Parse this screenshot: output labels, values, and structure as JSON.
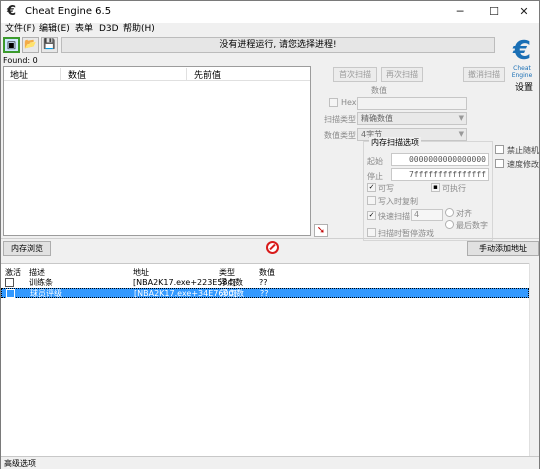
{
  "window": {
    "title": "Cheat Engine 6.5",
    "minimize": "─",
    "maximize": "☐",
    "close": "✕"
  },
  "menu": [
    "文件(F)",
    "编辑(E)",
    "表单",
    "D3D",
    "帮助(H)"
  ],
  "toolbar": {
    "process_label": "没有进程运行, 请您选择进程!",
    "logo_caption": "Cheat Engine",
    "settings_label": "设置"
  },
  "found_label": "Found: 0",
  "results": {
    "columns": [
      "地址",
      "数值",
      "先前值"
    ]
  },
  "scan": {
    "first_scan": "首次扫描",
    "next_scan": "再次扫描",
    "undo_scan": "撤消扫描",
    "value_label": "数值",
    "hex_label": "Hex",
    "scan_type_label": "扫描类型",
    "scan_type_value": "精确数值",
    "value_type_label": "数值类型",
    "value_type_value": "4字节"
  },
  "memory_options": {
    "title": "内存扫描选项",
    "start_label": "起始",
    "start_value": "0000000000000000",
    "stop_label": "停止",
    "stop_value": "7fffffffffffffff",
    "writable": "可写",
    "executable": "可执行",
    "copy_on_write": "写入时复制",
    "fast_scan": "快速扫描",
    "fast_scan_value": "4",
    "alignment": "对齐",
    "last_digits": "最后数字",
    "pause_game": "扫描时暂停游戏",
    "disable_random": "禁止随机",
    "speedhack": "速度修改"
  },
  "buttons": {
    "memory_view": "内存浏览",
    "add_manual": "手动添加地址"
  },
  "address_table": {
    "columns": [
      "激活",
      "描述",
      "地址",
      "类型",
      "数值"
    ],
    "rows": [
      {
        "desc": "训练条",
        "address": "[NBA2K17.exe+223E584]",
        "type": "浮点数",
        "value": "??"
      },
      {
        "desc": "球员评级",
        "address": "[NBA2K17.exe+34E7600]",
        "type": "浮点数",
        "value": "??"
      }
    ]
  },
  "status": {
    "advanced": "高级选项"
  }
}
